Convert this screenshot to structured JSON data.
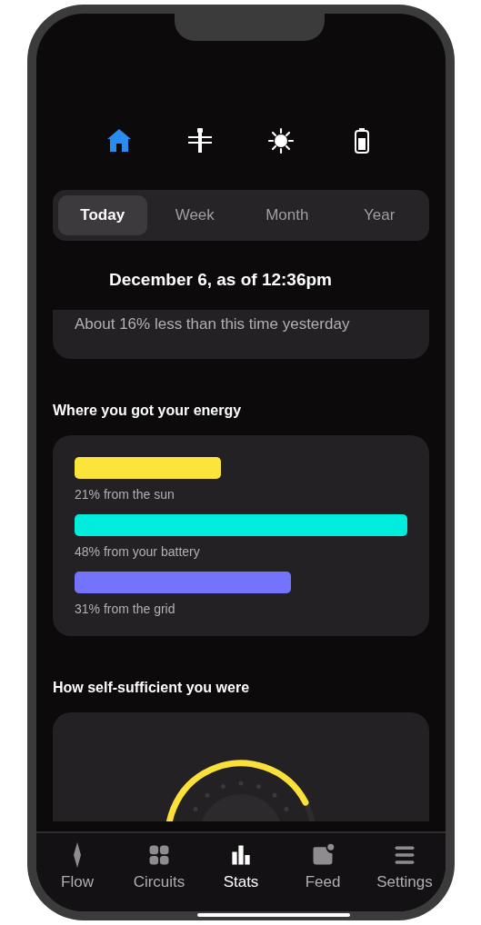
{
  "device_icons": [
    {
      "kind": "home",
      "selected": true
    },
    {
      "kind": "grid",
      "selected": false
    },
    {
      "kind": "sun",
      "selected": false
    },
    {
      "kind": "battery",
      "selected": false
    }
  ],
  "period_tabs": [
    {
      "label": "Today",
      "selected": true
    },
    {
      "label": "Week",
      "selected": false
    },
    {
      "label": "Month",
      "selected": false
    },
    {
      "label": "Year",
      "selected": false
    }
  ],
  "date_heading": "December 6, as of 12:36pm",
  "comparison": "About 16% less than this time yesterday",
  "energy_sources": {
    "title": "Where you got your energy",
    "items": [
      {
        "label": "21% from the sun",
        "color": "#fce53a"
      },
      {
        "label": "48% from your battery",
        "color": "#00ecdc"
      },
      {
        "label": "31% from the grid",
        "color": "#7373fb"
      }
    ]
  },
  "self_sufficiency": {
    "title": "How self-sufficient you were"
  },
  "nav": [
    {
      "label": "Flow",
      "kind": "flow",
      "selected": false
    },
    {
      "label": "Circuits",
      "kind": "circuits",
      "selected": false
    },
    {
      "label": "Stats",
      "kind": "stats",
      "selected": true
    },
    {
      "label": "Feed",
      "kind": "feed",
      "selected": false
    },
    {
      "label": "Settings",
      "kind": "settings",
      "selected": false
    }
  ]
}
